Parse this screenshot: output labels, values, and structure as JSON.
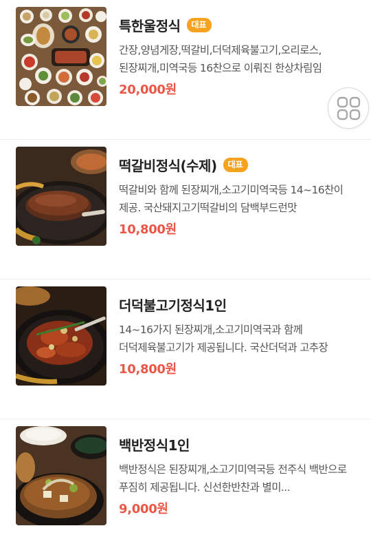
{
  "menu": {
    "items": [
      {
        "title": "특한울정식",
        "badge": "대표",
        "description": "간장,양념게장,떡갈비,더덕제육불고기,오리로스,된장찌개,미역국등 16찬으로 이뤄진 한상차림임",
        "price": "20,000원"
      },
      {
        "title": "떡갈비정식(수제)",
        "badge": "대표",
        "description": "떡갈비와 함께 된장찌개,소고기미역국등 14~16찬이 제공. 국산돼지고기떡갈비의 담백부드런맛",
        "price": "10,800원"
      },
      {
        "title": "더덕불고기정식1인",
        "badge": "",
        "description": "14~16가지 된장찌개,소고기미역국과 함께 더덕제육불고기가 제공됩니다. 국산더덕과 고추장",
        "price": "10,800원"
      },
      {
        "title": "백반정식1인",
        "badge": "",
        "description": "백반정식은 된장찌개,소고기미역국등 전주식 백반으로 푸짐히 제공됩니다. 신선한반찬과 별미...",
        "price": "9,000원"
      }
    ]
  },
  "floating_button": {
    "icon": "grid-icon"
  },
  "colors": {
    "price": "#ea5646",
    "badge": "#f6a21e",
    "title": "#222222",
    "description": "#555555"
  }
}
